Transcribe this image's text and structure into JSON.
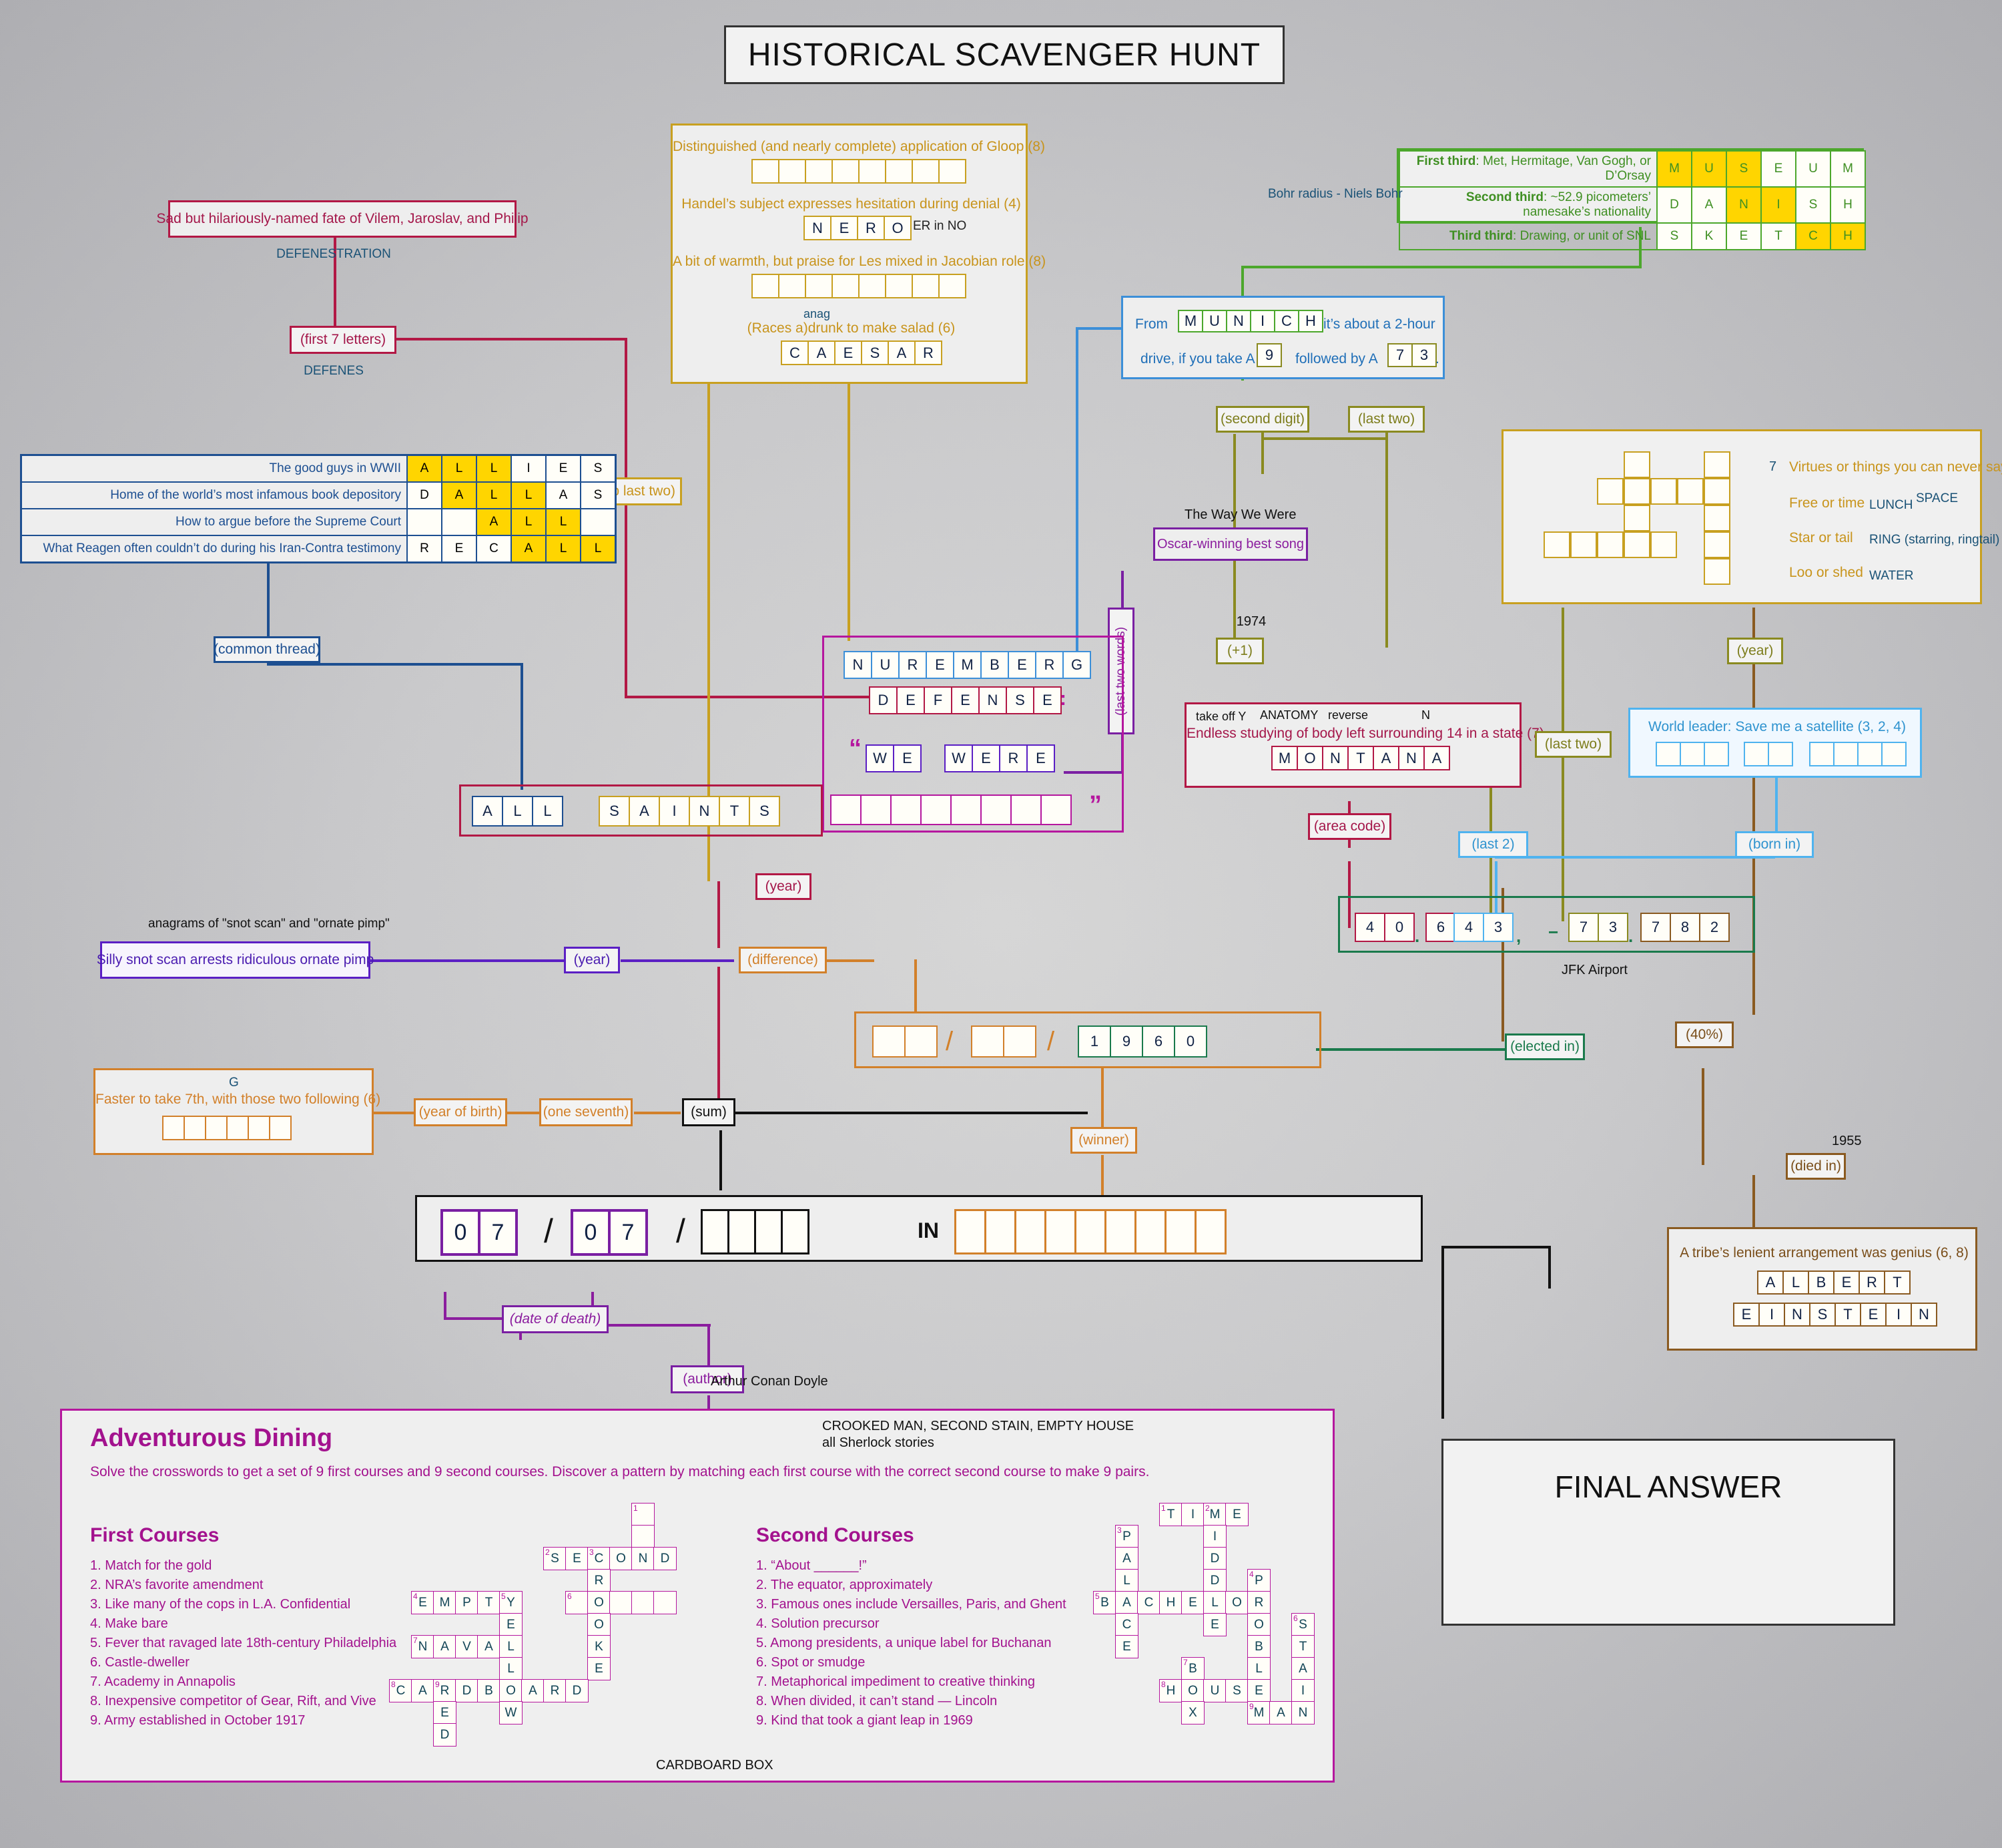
{
  "title": "HISTORICAL SCAVENGER HUNT",
  "final_answer_label": "FINAL ANSWER",
  "gold_panel": {
    "clue1": "Distinguished (and nearly complete) application of Gloop (8)",
    "clue1_cells": [
      "",
      "",
      "",
      "",
      "",
      "",
      "",
      ""
    ],
    "clue2": "Handel’s subject expresses hesitation during denial (4)",
    "clue2_cells": [
      "N",
      "E",
      "R",
      "O"
    ],
    "clue2_note": "ER in NO",
    "clue3": "A bit of warmth, but praise for Les mixed in Jacobian role (8)",
    "clue3_cells": [
      "",
      "",
      "",
      "",
      "",
      "",
      "",
      ""
    ],
    "clue4": "(Races a)drunk to make salad (6)",
    "clue4_note": "anag",
    "clue4_cells": [
      "C",
      "A",
      "E",
      "S",
      "A",
      "R"
    ]
  },
  "defenestration": {
    "clue": "Sad but hilariously-named fate of Vilem, Jaroslav, and Philip",
    "answer_note": "DEFENESTRATION",
    "link_label": "(first 7 letters)",
    "result_note": "DEFENES"
  },
  "green_panel": {
    "rows": [
      {
        "label_bold": "First third",
        "label_rest": ": Met, Hermitage, Van Gogh, or D’Orsay",
        "cells": [
          "M",
          "U",
          "S",
          "E",
          "U",
          "M"
        ],
        "highlight": [
          0,
          1,
          2
        ]
      },
      {
        "label_bold": "Second third",
        "label_rest": ": ~52.9 picometers’ namesake’s nationality",
        "cells": [
          "D",
          "A",
          "N",
          "I",
          "S",
          "H"
        ],
        "highlight": [
          2,
          3
        ]
      },
      {
        "label_bold": "Third third",
        "label_rest": ": Drawing, or unit of SNL",
        "cells": [
          "S",
          "K",
          "E",
          "T",
          "C",
          "H"
        ],
        "highlight": [
          4,
          5
        ]
      }
    ],
    "side_note": "Bohr radius - Niels Bohr"
  },
  "allies_table": {
    "rows": [
      {
        "clue": "The good guys in WWII",
        "cells": [
          "A",
          "L",
          "L",
          "I",
          "E",
          "S"
        ],
        "highlight": [
          0,
          1,
          2
        ]
      },
      {
        "clue": "Home of the world’s most infamous book depository",
        "cells": [
          "D",
          "A",
          "L",
          "L",
          "A",
          "S"
        ],
        "highlight": [
          1,
          2,
          3
        ]
      },
      {
        "clue": "How to argue before the Supreme Court",
        "cells": [
          "",
          "",
          "A",
          "L",
          "L",
          ""
        ],
        "highlight": [
          2,
          3,
          4
        ]
      },
      {
        "clue": "What Reagen often couldn’t do during his Iran-Contra testimony",
        "cells": [
          "R",
          "E",
          "C",
          "A",
          "L",
          "L"
        ],
        "highlight": [
          3,
          4,
          5
        ]
      }
    ],
    "link_label": "(common thread)"
  },
  "munich": {
    "pre": "From",
    "cells": [
      "M",
      "U",
      "N",
      "I",
      "C",
      "H"
    ],
    "mid": "it’s about a 2-hour",
    "line2_pre": "drive, if you take A",
    "digit1": "9",
    "line2_mid": "followed by A",
    "digit2a": "7",
    "digit2b": "3",
    "tail": ".",
    "link_second_digit": "(second digit)",
    "link_last_two": "(last two)"
  },
  "oscar": {
    "header": "The Way We Were",
    "box": "Oscar-winning best song",
    "year": "1974",
    "link_plus1": "(+1)",
    "link_last_two_words": "(last two words)"
  },
  "center_panel": {
    "nuremberg": [
      "N",
      "U",
      "R",
      "E",
      "M",
      "B",
      "E",
      "R",
      "G"
    ],
    "defense": [
      "D",
      "E",
      "F",
      "E",
      "N",
      "S",
      "E"
    ],
    "colon": ":",
    "quote_open": "“",
    "we": [
      "W",
      "E"
    ],
    "were": [
      "W",
      "E",
      "R",
      "E"
    ],
    "quote_close": "”",
    "blank_quote": [
      "",
      "",
      "",
      "",
      "",
      "",
      "",
      ""
    ],
    "all": [
      "A",
      "L",
      "L"
    ],
    "saints": [
      "S",
      "A",
      "I",
      "N",
      "T",
      "S"
    ]
  },
  "montana": {
    "notes": [
      "take off Y",
      "ANATOMY",
      "reverse",
      "N"
    ],
    "clue": "Endless studying of body left surrounding 14 in a state (7)",
    "cells": [
      "M",
      "O",
      "N",
      "T",
      "A",
      "N",
      "A"
    ],
    "link_area_code": "(area code)",
    "link_last_two": "(last two)"
  },
  "world_leader": {
    "clue": "World leader: Save me a satellite (3, 2, 4)",
    "group1": [
      "",
      "",
      ""
    ],
    "group2": [
      "",
      ""
    ],
    "group3": [
      "",
      "",
      "",
      ""
    ],
    "link_born_in": "(born in)",
    "link_last2": "(last 2)"
  },
  "top_right_cross": {
    "number": "7",
    "clues": [
      {
        "text": "Virtues or things you can never say on TV",
        "answer": ""
      },
      {
        "text": "Free or time",
        "answer": "LUNCH",
        "answer2": "SPACE"
      },
      {
        "text": "Star or tail",
        "answer": "RING (starring, ringtail)"
      },
      {
        "text": "Loo or shed",
        "answer": "WATER"
      }
    ],
    "link_year": "(year)"
  },
  "jfk": {
    "cells1": [
      "4",
      "0"
    ],
    "dot1": ".",
    "cells2": [
      "6"
    ],
    "cells3": [
      "4",
      "3"
    ],
    "comma": ",",
    "minus": "−",
    "cells4": [
      "7",
      "3"
    ],
    "dot2": ".",
    "cells5": [
      "7",
      "8",
      "2"
    ],
    "caption": "JFK Airport",
    "link_elected_in": "(elected in)",
    "link_40": "(40%)"
  },
  "snot_scan": {
    "note": "anagrams of \"snot scan\" and \"ornate pimp\"",
    "clue": "Silly snot scan arrests ridiculous ornate pimp",
    "link_year": "(year)",
    "link_difference": "(difference)",
    "link_year_center": "(year)"
  },
  "fraction_panel": {
    "g1": [
      "",
      ""
    ],
    "slash1": "/",
    "g2": [
      "",
      ""
    ],
    "slash2": "/",
    "year": [
      "1",
      "9",
      "6",
      "0"
    ],
    "link_winner": "(winner)"
  },
  "faster": {
    "note": "G",
    "clue": "Faster to take 7th, with those two following (6)",
    "cells": [
      "",
      "",
      "",
      "",
      "",
      ""
    ],
    "link_year_of_birth": "(year of birth)",
    "link_one_seventh": "(one seventh)",
    "link_sum": "(sum)"
  },
  "answer_row": {
    "d1": [
      "0",
      "7"
    ],
    "slash1": "/",
    "d2": [
      "0",
      "7"
    ],
    "slash2": "/",
    "d3": [
      "",
      "",
      "",
      ""
    ],
    "in": "IN",
    "word": [
      "",
      "",
      "",
      "",
      "",
      "",
      "",
      "",
      ""
    ],
    "link_date_of_death": "(date of death)",
    "link_author": "(author)",
    "author_note": "Arthur Conan Doyle"
  },
  "einstein": {
    "year": "1955",
    "link_died_in": "(died in)",
    "clue": "A tribe’s lenient arrangement was genius (6, 8)",
    "row1": [
      "A",
      "L",
      "B",
      "E",
      "R",
      "T"
    ],
    "row2": [
      "E",
      "I",
      "N",
      "S",
      "T",
      "E",
      "I",
      "N"
    ]
  },
  "dining": {
    "title": "Adventurous Dining",
    "subtitle": "Solve the crosswords to get a set of 9 first courses and 9 second courses. Discover a pattern by matching each first course with the correct second course to make 9 pairs.",
    "note_top": "CROOKED MAN, SECOND STAIN, EMPTY HOUSE",
    "note_top2": "all Sherlock stories",
    "note_bottom": "CARDBOARD BOX",
    "first_heading": "First Courses",
    "first_clues": [
      "1. Match for the gold",
      "2. NRA’s favorite amendment",
      "3. Like many of the cops in L.A. Confidential",
      "4. Make bare",
      "5. Fever that ravaged late 18th-century Philadelphia",
      "6. Castle-dweller",
      "7. Academy in Annapolis",
      "8. Inexpensive competitor of Gear, Rift, and Vive",
      "9. Army established in October 1917"
    ],
    "second_heading": "Second Courses",
    "second_clues": [
      "1. “About ______!”",
      "2. The equator, approximately",
      "3. Famous ones include Versailles, Paris, and Ghent",
      "4. Solution precursor",
      "5. Among presidents, a unique label for Buchanan",
      "6. Spot or smudge",
      "7. Metaphorical impediment to creative thinking",
      "8. When divided, it can’t stand — Lincoln",
      "9. Kind that took a giant leap in 1969"
    ],
    "grid1": [
      {
        "c": 11,
        "r": 0,
        "l": "",
        "n": "1"
      },
      {
        "c": 11,
        "r": 1,
        "l": ""
      },
      {
        "c": 7,
        "r": 2,
        "l": "S",
        "n": "2"
      },
      {
        "c": 8,
        "r": 2,
        "l": "E"
      },
      {
        "c": 9,
        "r": 2,
        "l": "C",
        "n": "3"
      },
      {
        "c": 10,
        "r": 2,
        "l": "O"
      },
      {
        "c": 11,
        "r": 2,
        "l": "N"
      },
      {
        "c": 12,
        "r": 2,
        "l": "D"
      },
      {
        "c": 9,
        "r": 3,
        "l": "R"
      },
      {
        "c": 1,
        "r": 4,
        "l": "E",
        "n": "4"
      },
      {
        "c": 2,
        "r": 4,
        "l": "M"
      },
      {
        "c": 3,
        "r": 4,
        "l": "P"
      },
      {
        "c": 4,
        "r": 4,
        "l": "T"
      },
      {
        "c": 5,
        "r": 4,
        "l": "Y",
        "n": "5"
      },
      {
        "c": 8,
        "r": 4,
        "l": "",
        "n": "6"
      },
      {
        "c": 9,
        "r": 4,
        "l": "O"
      },
      {
        "c": 10,
        "r": 4,
        "l": ""
      },
      {
        "c": 11,
        "r": 4,
        "l": ""
      },
      {
        "c": 12,
        "r": 4,
        "l": ""
      },
      {
        "c": 5,
        "r": 5,
        "l": "E"
      },
      {
        "c": 9,
        "r": 5,
        "l": "O"
      },
      {
        "c": 1,
        "r": 6,
        "l": "N",
        "n": "7"
      },
      {
        "c": 2,
        "r": 6,
        "l": "A"
      },
      {
        "c": 3,
        "r": 6,
        "l": "V"
      },
      {
        "c": 4,
        "r": 6,
        "l": "A"
      },
      {
        "c": 5,
        "r": 6,
        "l": "L"
      },
      {
        "c": 9,
        "r": 6,
        "l": "K"
      },
      {
        "c": 5,
        "r": 7,
        "l": "L"
      },
      {
        "c": 9,
        "r": 7,
        "l": "E"
      },
      {
        "c": 0,
        "r": 8,
        "l": "C",
        "n": "8"
      },
      {
        "c": 1,
        "r": 8,
        "l": "A"
      },
      {
        "c": 2,
        "r": 8,
        "l": "R",
        "n": "9"
      },
      {
        "c": 3,
        "r": 8,
        "l": "D"
      },
      {
        "c": 4,
        "r": 8,
        "l": "B"
      },
      {
        "c": 5,
        "r": 8,
        "l": "O"
      },
      {
        "c": 6,
        "r": 8,
        "l": "A"
      },
      {
        "c": 7,
        "r": 8,
        "l": "R"
      },
      {
        "c": 8,
        "r": 8,
        "l": "D"
      },
      {
        "c": 2,
        "r": 9,
        "l": "E"
      },
      {
        "c": 5,
        "r": 9,
        "l": "W"
      },
      {
        "c": 2,
        "r": 10,
        "l": "D"
      }
    ],
    "grid2": [
      {
        "c": 2,
        "r": 0,
        "l": "T",
        "n": "1"
      },
      {
        "c": 3,
        "r": 0,
        "l": "I"
      },
      {
        "c": 4,
        "r": 0,
        "l": "M",
        "n": "2"
      },
      {
        "c": 5,
        "r": 0,
        "l": "E"
      },
      {
        "c": 0,
        "r": 1,
        "l": "P",
        "n": "3"
      },
      {
        "c": 4,
        "r": 1,
        "l": "I"
      },
      {
        "c": 0,
        "r": 2,
        "l": "A"
      },
      {
        "c": 4,
        "r": 2,
        "l": "D"
      },
      {
        "c": 0,
        "r": 3,
        "l": "L"
      },
      {
        "c": 4,
        "r": 3,
        "l": "D"
      },
      {
        "c": 6,
        "r": 3,
        "l": "P",
        "n": "4"
      },
      {
        "c": -1,
        "r": 4,
        "l": "B",
        "n": "5"
      },
      {
        "c": 0,
        "r": 4,
        "l": "A"
      },
      {
        "c": 1,
        "r": 4,
        "l": "C"
      },
      {
        "c": 2,
        "r": 4,
        "l": "H"
      },
      {
        "c": 3,
        "r": 4,
        "l": "E"
      },
      {
        "c": 4,
        "r": 4,
        "l": "L"
      },
      {
        "c": 5,
        "r": 4,
        "l": "O"
      },
      {
        "c": 6,
        "r": 4,
        "l": "R"
      },
      {
        "c": 0,
        "r": 5,
        "l": "C"
      },
      {
        "c": 4,
        "r": 5,
        "l": "E"
      },
      {
        "c": 6,
        "r": 5,
        "l": "O"
      },
      {
        "c": 8,
        "r": 5,
        "l": "S",
        "n": "6"
      },
      {
        "c": 0,
        "r": 6,
        "l": "E"
      },
      {
        "c": 6,
        "r": 6,
        "l": "B"
      },
      {
        "c": 8,
        "r": 6,
        "l": "T"
      },
      {
        "c": 3,
        "r": 7,
        "l": "B",
        "n": "7"
      },
      {
        "c": 6,
        "r": 7,
        "l": "L"
      },
      {
        "c": 8,
        "r": 7,
        "l": "A"
      },
      {
        "c": 2,
        "r": 8,
        "l": "H",
        "n": "8"
      },
      {
        "c": 3,
        "r": 8,
        "l": "O"
      },
      {
        "c": 4,
        "r": 8,
        "l": "U"
      },
      {
        "c": 5,
        "r": 8,
        "l": "S"
      },
      {
        "c": 6,
        "r": 8,
        "l": "E"
      },
      {
        "c": 8,
        "r": 8,
        "l": "I"
      },
      {
        "c": 3,
        "r": 9,
        "l": "X"
      },
      {
        "c": 6,
        "r": 9,
        "l": "M",
        "n": "9"
      },
      {
        "c": 7,
        "r": 9,
        "l": "A"
      },
      {
        "c": 8,
        "r": 9,
        "l": "N"
      }
    ]
  }
}
